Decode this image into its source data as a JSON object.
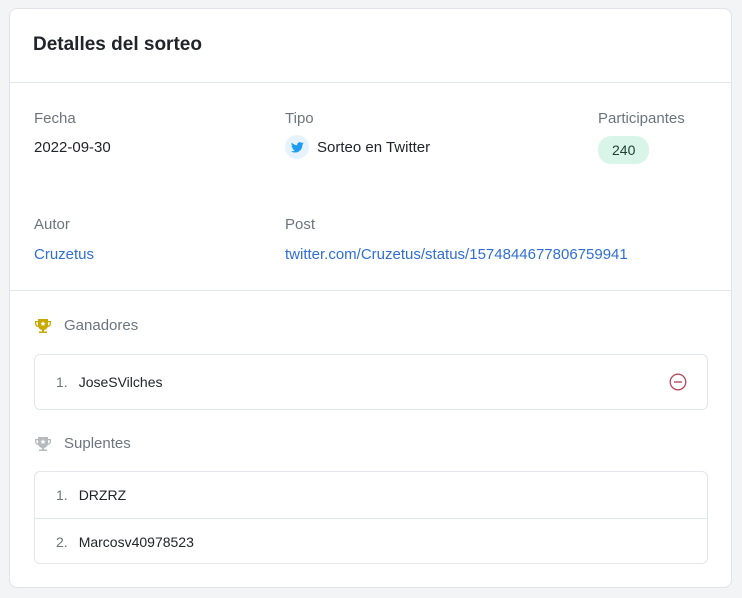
{
  "header": {
    "title": "Detalles del sorteo"
  },
  "details": {
    "fecha": {
      "label": "Fecha",
      "value": "2022-09-30"
    },
    "tipo": {
      "label": "Tipo",
      "value": "Sorteo en Twitter",
      "icon": "twitter-icon"
    },
    "participantes": {
      "label": "Participantes",
      "value": "240"
    },
    "autor": {
      "label": "Autor",
      "value": "Cruzetus"
    },
    "post": {
      "label": "Post",
      "value": "twitter.com/Cruzetus/status/1574844677806759941"
    }
  },
  "ganadores": {
    "title": "Ganadores",
    "icon": "trophy-icon",
    "items": [
      {
        "num": "1.",
        "name": "JoseSVilches"
      }
    ]
  },
  "suplentes": {
    "title": "Suplentes",
    "icon": "trophy-icon",
    "items": [
      {
        "num": "1.",
        "name": "DRZRZ"
      },
      {
        "num": "2.",
        "name": "Marcosv40978523"
      }
    ]
  },
  "colors": {
    "link": "#2f6fd6",
    "trophy_gold": "#c9a800",
    "trophy_gray": "#b7babd",
    "badge_bg": "#d9f5e9",
    "remove": "#b5495b",
    "twitter": "#1d9bf0"
  }
}
